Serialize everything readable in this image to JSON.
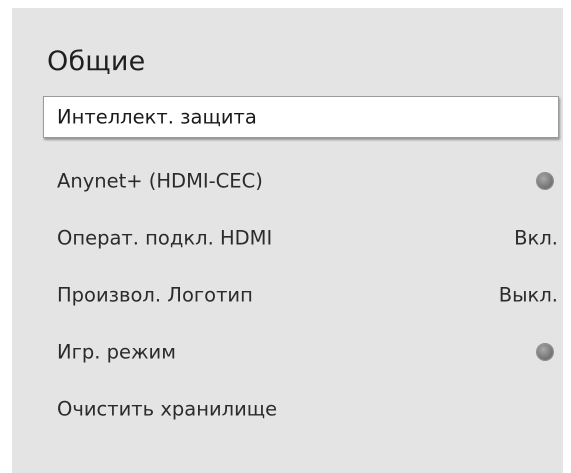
{
  "panel": {
    "title": "Общие"
  },
  "menu": {
    "items": [
      {
        "label": "Интеллект. защита",
        "selected": true
      },
      {
        "label": "Anynet+ (HDMI-CEC)",
        "toggle_icon": "toggle-off-icon"
      },
      {
        "label": "Операт. подкл. HDMI",
        "value": "Вкл."
      },
      {
        "label": "Произвол. Логотип",
        "value": "Выкл."
      },
      {
        "label": "Игр. режим",
        "toggle_icon": "toggle-off-icon"
      },
      {
        "label": "Очистить хранилище"
      }
    ]
  },
  "colors": {
    "panel_background": "#e4e4e4",
    "selected_background": "#ffffff",
    "text": "#2b2b2b",
    "toggle_off": "#7c7c7c"
  }
}
